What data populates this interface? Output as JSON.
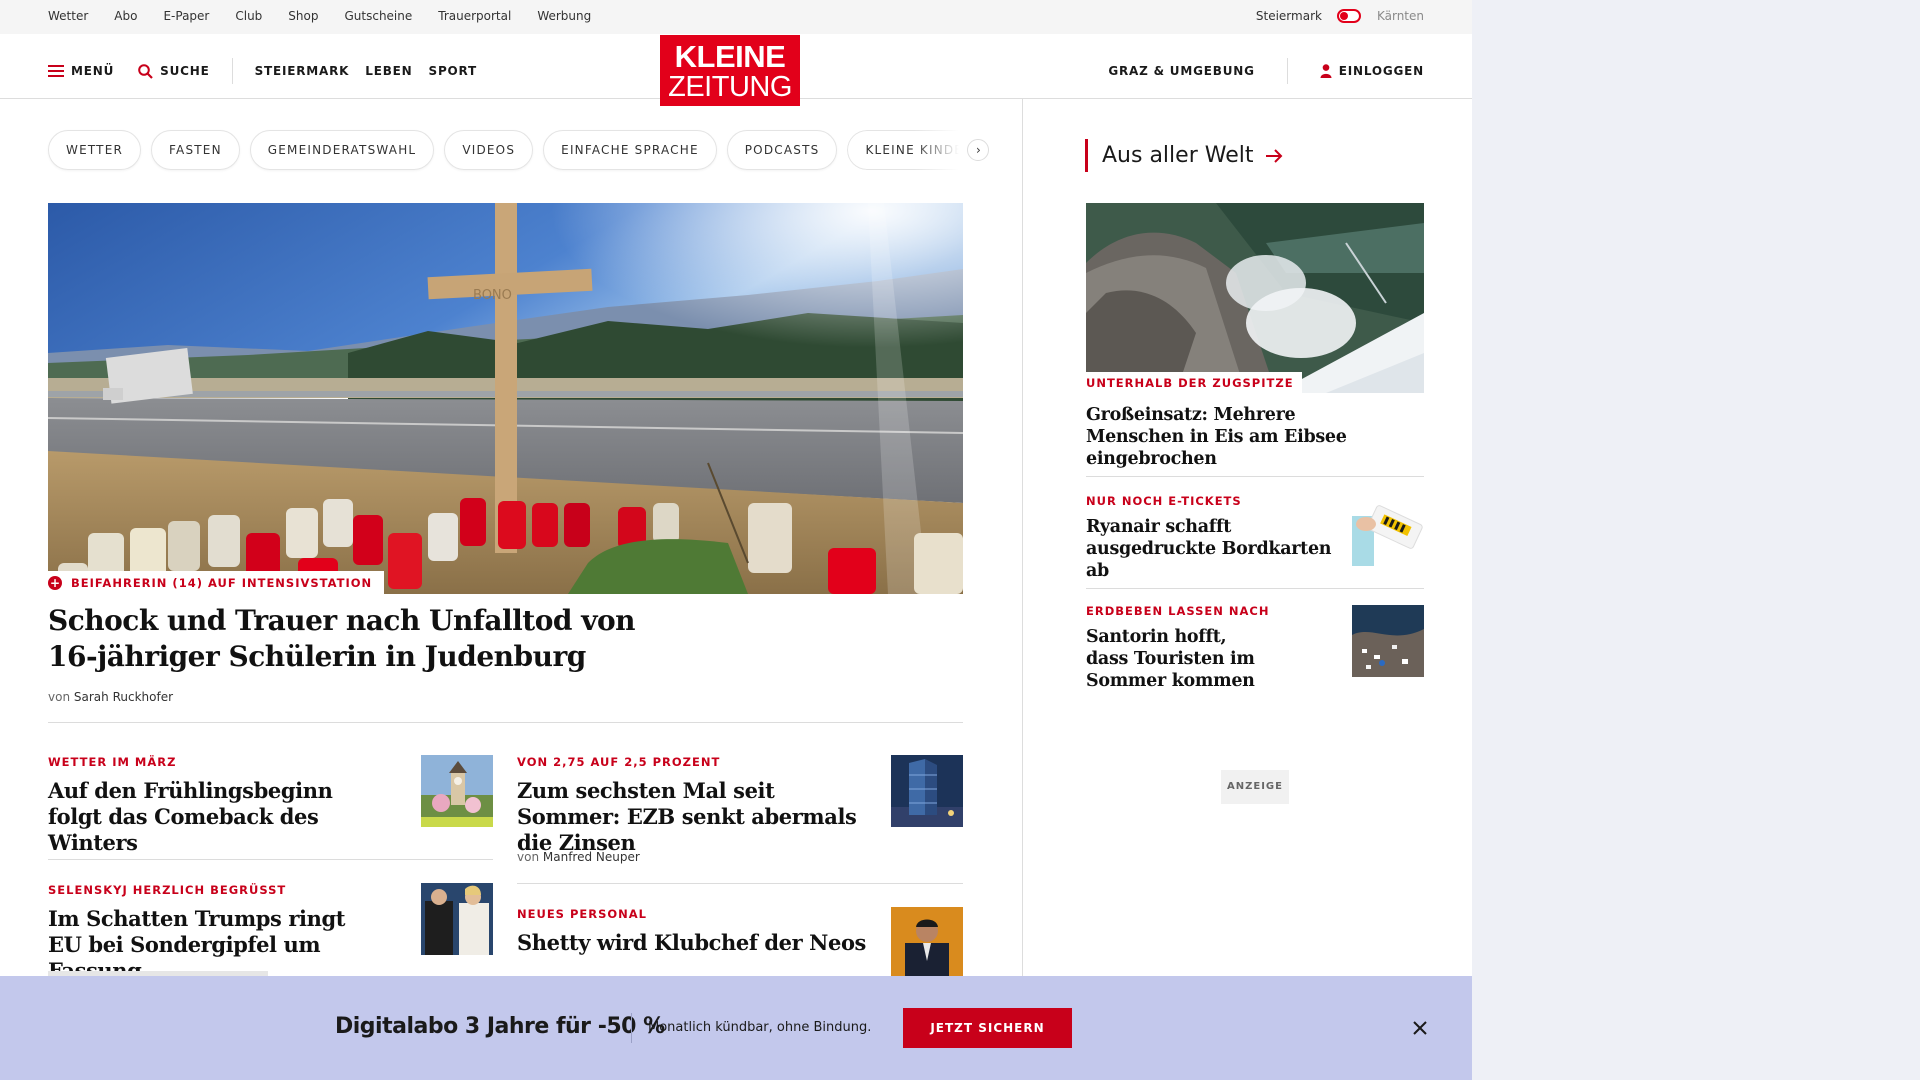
{
  "topbar": {
    "links": [
      "Wetter",
      "Abo",
      "E-Paper",
      "Club",
      "Shop",
      "Gutscheine",
      "Trauerportal",
      "Werbung"
    ],
    "region_active": "Steiermark",
    "region_inactive": "Kärnten"
  },
  "header": {
    "menu_label": "MENÜ",
    "search_label": "SUCHE",
    "nav": [
      "STEIERMARK",
      "LEBEN",
      "SPORT"
    ],
    "logo_line1": "KLEINE",
    "logo_line2": "ZEITUNG",
    "location_label": "GRAZ & UMGEBUNG",
    "login_label": "EINLOGGEN"
  },
  "chips": [
    "WETTER",
    "FASTEN",
    "GEMEINDERATSWAHL",
    "VIDEOS",
    "EINFACHE SPRACHE",
    "PODCASTS",
    "KLEINE KINDE"
  ],
  "chip_next": "›",
  "hero": {
    "kicker": "BEIFAHRERIN (14) AUF INTENSIVSTATION",
    "title": "Schock und Trauer nach Unfalltod von 16-jähriger Schülerin in Judenburg",
    "byline_prefix": "von",
    "author": "Sarah Ruckhofer",
    "cross_text": "BONO"
  },
  "stories": [
    {
      "kicker": "WETTER IM MÄRZ",
      "title": "Auf den Frühlingsbeginn folgt das Comeback des Winters"
    },
    {
      "kicker": "VON 2,75 AUF 2,5 PROZENT",
      "title": "Zum sechsten Mal seit Sommer: EZB senkt abermals die Zinsen",
      "byline_prefix": "von",
      "author": "Manfred Neuper"
    },
    {
      "kicker": "SELENSKYJ HERZLICH BEGRÜSST",
      "title": "Im Schatten Trumps ringt EU bei Sondergipfel um Fassung"
    },
    {
      "kicker": "NEUES PERSONAL",
      "title": "Shetty wird Klubchef der Neos"
    }
  ],
  "sidebar": {
    "heading": "Aus aller Welt",
    "items": [
      {
        "kicker": "UNTERHALB DER ZUGSPITZE",
        "title": "Großeinsatz: Mehrere Menschen in Eis am Eibsee eingebrochen"
      },
      {
        "kicker": "NUR NOCH E-TICKETS",
        "title": "Ryanair schafft ausgedruckte Bordkarten ab"
      },
      {
        "kicker": "ERDBEBEN LASSEN NACH",
        "title": "Santorin hofft, dass Touristen im Sommer kommen"
      }
    ],
    "ad_label": "ANZEIGE"
  },
  "banner": {
    "title": "Digitalabo 3 Jahre für -50 %",
    "text": "Monatlich kündbar, ohne Bindung.",
    "button": "JETZT SICHERN"
  },
  "colors": {
    "brand": "#e2001a",
    "kicker": "#c8001a",
    "banner_bg": "#c3c8ec"
  }
}
